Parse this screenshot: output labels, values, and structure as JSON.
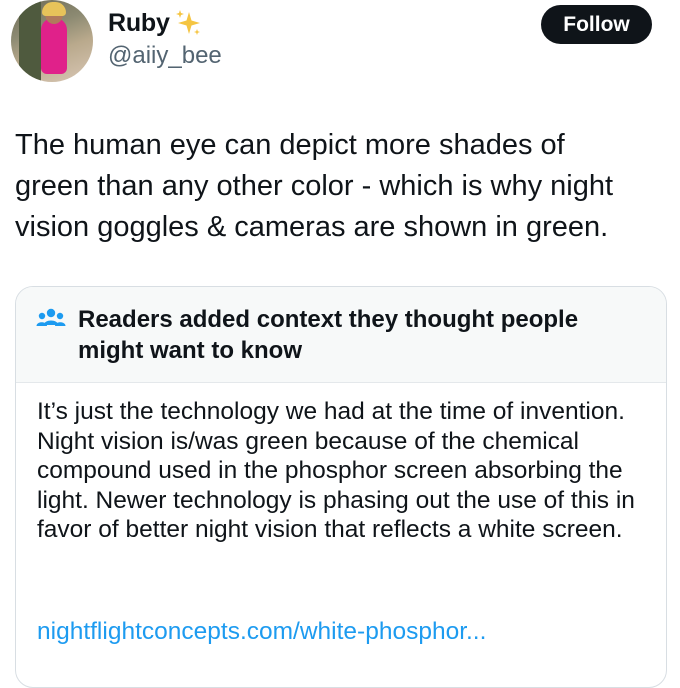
{
  "author": {
    "name": "Ruby",
    "handle": "@aiiy_bee",
    "verified_emoji_icon": "sparkles-icon"
  },
  "follow_button": {
    "label": "Follow"
  },
  "tweet": {
    "text": "The human eye can depict more shades of\ngreen than any other color - which is why night\nvision goggles & cameras are shown in green."
  },
  "community_note": {
    "icon": "people-icon",
    "title": "Readers added context they thought people might want to know",
    "body": "It’s just the technology we had at the time of invention. Night vision is/was green because of the chemical compound used in the phosphor screen absorbing the light. Newer technology is phasing out the use of this in favor of better night vision that reflects a white screen.",
    "link": "nightflightconcepts.com/white-phosphor..."
  },
  "colors": {
    "text": "#0f1419",
    "secondary_text": "#536471",
    "link": "#1d9bf0",
    "follow_bg": "#0f1419",
    "note_header_bg": "#f7f9f9",
    "sparkle": "#f5c542"
  }
}
